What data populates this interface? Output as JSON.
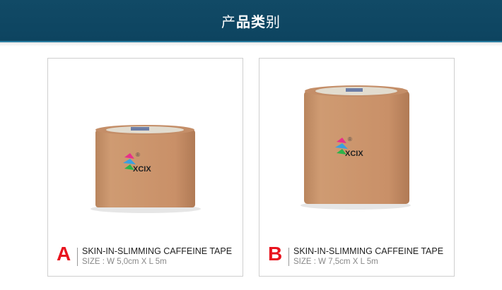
{
  "header": {
    "title_pre": "产",
    "title_bold": "品类",
    "title_post": "别",
    "background": "#114a66"
  },
  "products": [
    {
      "letter": "A",
      "title": "SKIN-IN-SLIMMING CAFFEINE TAPE",
      "size": "SIZE : W 5,0cm X L 5m",
      "brand": "XCIX",
      "registered": "®"
    },
    {
      "letter": "B",
      "title": "SKIN-IN-SLIMMING CAFFEINE TAPE",
      "size": "SIZE : W 7,5cm X L 5m",
      "brand": "XCIX",
      "registered": "®"
    }
  ],
  "colors": {
    "accent_letter": "#e8141e",
    "tape": "#c8956c",
    "card_border": "#cfcfcf"
  }
}
